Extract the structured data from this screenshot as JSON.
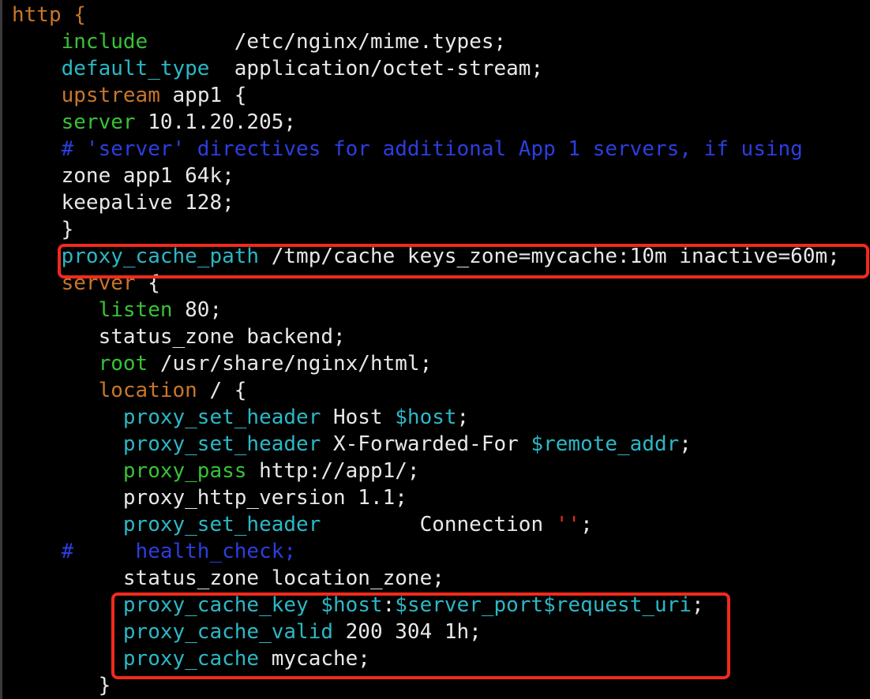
{
  "colors": {
    "background": "#000000",
    "plain": "#e8e8e8",
    "keyword": "#c8762a",
    "directive_green": "#38c238",
    "directive_cyan": "#2bb8c6",
    "comment": "#2c3ee0",
    "string": "#e0302a",
    "highlight": "#f02a1c"
  },
  "lines": [
    {
      "indent": "",
      "segments": [
        {
          "text": "http {",
          "style": "orange"
        }
      ]
    },
    {
      "indent": "    ",
      "segments": [
        {
          "text": "include",
          "style": "green"
        },
        {
          "text": "       /etc/nginx/mime.types;",
          "style": "plain"
        }
      ]
    },
    {
      "indent": "    ",
      "segments": [
        {
          "text": "default_type",
          "style": "cyan"
        },
        {
          "text": "  application/octet-stream;",
          "style": "plain"
        }
      ]
    },
    {
      "indent": "    ",
      "segments": [
        {
          "text": "upstream",
          "style": "orange"
        },
        {
          "text": " app1 {",
          "style": "plain"
        }
      ]
    },
    {
      "indent": "    ",
      "segments": [
        {
          "text": "server",
          "style": "green"
        },
        {
          "text": " 10.1.20.205;",
          "style": "plain"
        }
      ]
    },
    {
      "indent": "    ",
      "segments": [
        {
          "text": "# 'server' directives for additional App 1 servers, if using",
          "style": "blue"
        }
      ]
    },
    {
      "indent": "    ",
      "segments": [
        {
          "text": "zone app1 64k;",
          "style": "plain"
        }
      ]
    },
    {
      "indent": "    ",
      "segments": [
        {
          "text": "keepalive 128;",
          "style": "plain"
        }
      ]
    },
    {
      "indent": "    ",
      "segments": [
        {
          "text": "}",
          "style": "plain"
        }
      ]
    },
    {
      "indent": "    ",
      "segments": [
        {
          "text": "proxy_cache_path",
          "style": "cyan"
        },
        {
          "text": " /tmp/cache keys_zone=mycache:10m inactive=60m;",
          "style": "plain"
        }
      ]
    },
    {
      "indent": "    ",
      "segments": [
        {
          "text": "server",
          "style": "orange"
        },
        {
          "text": " {",
          "style": "plain"
        }
      ]
    },
    {
      "indent": "       ",
      "segments": [
        {
          "text": "listen",
          "style": "green"
        },
        {
          "text": " 80;",
          "style": "plain"
        }
      ]
    },
    {
      "indent": "       ",
      "segments": [
        {
          "text": "status_zone backend;",
          "style": "plain"
        }
      ]
    },
    {
      "indent": "       ",
      "segments": [
        {
          "text": "root",
          "style": "green"
        },
        {
          "text": " /usr/share/nginx/html;",
          "style": "plain"
        }
      ]
    },
    {
      "indent": "       ",
      "segments": [
        {
          "text": "location",
          "style": "orange"
        },
        {
          "text": " / {",
          "style": "plain"
        }
      ]
    },
    {
      "indent": "         ",
      "segments": [
        {
          "text": "proxy_set_header",
          "style": "cyan"
        },
        {
          "text": " Host ",
          "style": "plain"
        },
        {
          "text": "$host",
          "style": "cyan"
        },
        {
          "text": ";",
          "style": "plain"
        }
      ]
    },
    {
      "indent": "         ",
      "segments": [
        {
          "text": "proxy_set_header",
          "style": "cyan"
        },
        {
          "text": " X-Forwarded-For ",
          "style": "plain"
        },
        {
          "text": "$remote_addr",
          "style": "cyan"
        },
        {
          "text": ";",
          "style": "plain"
        }
      ]
    },
    {
      "indent": "         ",
      "segments": [
        {
          "text": "proxy_pass",
          "style": "green"
        },
        {
          "text": " http://app1/;",
          "style": "plain"
        }
      ]
    },
    {
      "indent": "         ",
      "segments": [
        {
          "text": "proxy_http_version 1.1;",
          "style": "plain"
        }
      ]
    },
    {
      "indent": "         ",
      "segments": [
        {
          "text": "proxy_set_header",
          "style": "cyan"
        },
        {
          "text": "        Connection ",
          "style": "plain"
        },
        {
          "text": "''",
          "style": "red"
        },
        {
          "text": ";",
          "style": "plain"
        }
      ]
    },
    {
      "indent": "    ",
      "segments": [
        {
          "text": "#     health_check;",
          "style": "blue"
        }
      ]
    },
    {
      "indent": "         ",
      "segments": [
        {
          "text": "status_zone location_zone;",
          "style": "plain"
        }
      ]
    },
    {
      "indent": "         ",
      "segments": [
        {
          "text": "proxy_cache_key",
          "style": "cyan"
        },
        {
          "text": " ",
          "style": "plain"
        },
        {
          "text": "$host",
          "style": "cyan"
        },
        {
          "text": ":",
          "style": "plain"
        },
        {
          "text": "$server_port$request_uri",
          "style": "cyan"
        },
        {
          "text": ";",
          "style": "plain"
        }
      ]
    },
    {
      "indent": "         ",
      "segments": [
        {
          "text": "proxy_cache_valid",
          "style": "cyan"
        },
        {
          "text": " 200 304 1h;",
          "style": "plain"
        }
      ]
    },
    {
      "indent": "         ",
      "segments": [
        {
          "text": "proxy_cache",
          "style": "cyan"
        },
        {
          "text": " mycache;",
          "style": "plain"
        }
      ]
    },
    {
      "indent": "       ",
      "segments": [
        {
          "text": "}",
          "style": "plain"
        }
      ]
    }
  ]
}
